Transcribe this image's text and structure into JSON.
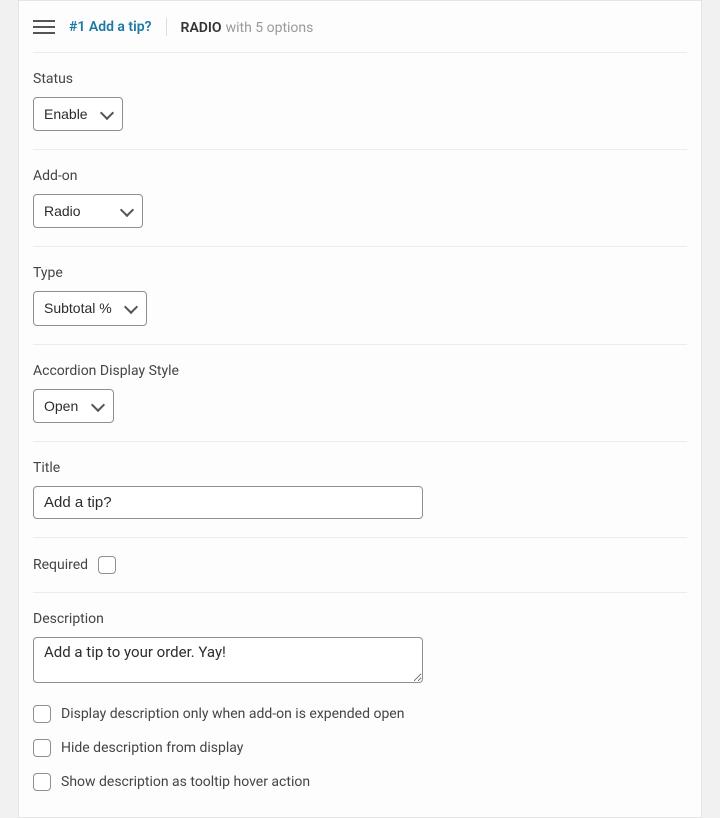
{
  "header": {
    "title": "#1 Add a tip?",
    "type_label": "RADIO",
    "options_label": "with 5 options"
  },
  "status": {
    "label": "Status",
    "value": "Enable"
  },
  "addon": {
    "label": "Add-on",
    "value": "Radio"
  },
  "type": {
    "label": "Type",
    "value": "Subtotal %"
  },
  "accordion": {
    "label": "Accordion Display Style",
    "value": "Open"
  },
  "title_field": {
    "label": "Title",
    "value": "Add a tip?"
  },
  "required": {
    "label": "Required"
  },
  "description": {
    "label": "Description",
    "value": "Add a tip to your order. Yay!"
  },
  "options": {
    "display_expanded": "Display description only when add-on is expended open",
    "hide_description": "Hide description from display",
    "tooltip_hover": "Show description as tooltip hover action"
  }
}
